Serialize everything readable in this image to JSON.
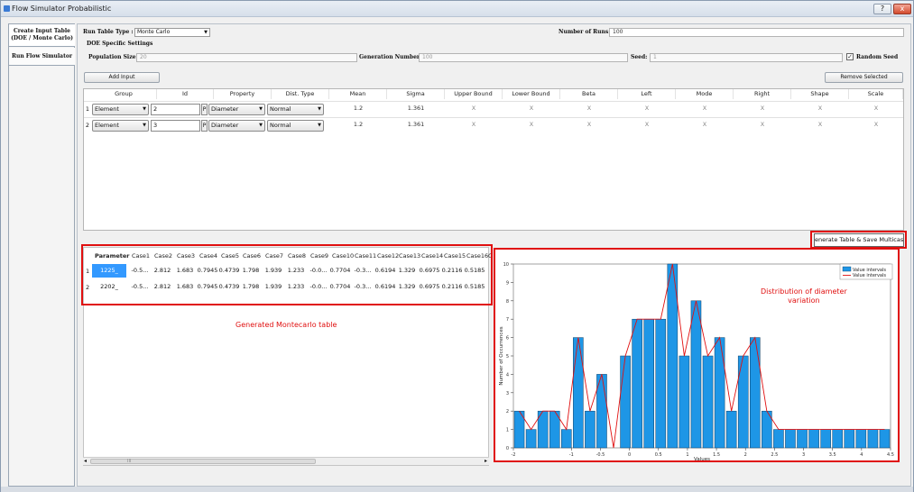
{
  "window": {
    "title": "Flow Simulator Probabilistic",
    "help_label": "?",
    "close_label": "x"
  },
  "sidebar": {
    "tabs": [
      {
        "label": "Create Input Table\n(DOE / Monte Carlo)"
      },
      {
        "label": "Run Flow Simulator"
      }
    ]
  },
  "settings": {
    "run_table_type_label": "Run Table Type :",
    "run_table_type_value": "Monte Carlo",
    "number_of_runs_label": "Number of Runs:",
    "number_of_runs_value": "100",
    "doe_settings_label": "DOE Specific Settings",
    "population_size_label": "Population Size:",
    "population_size_value": "20",
    "generation_number_label": "Generation Number:",
    "generation_number_value": "100",
    "seed_label": "Seed:",
    "seed_value": "1",
    "random_seed_label": "Random Seed",
    "random_seed_checked": true
  },
  "buttons": {
    "add_input": "Add Input",
    "remove_selected": "Remove Selected",
    "generate": "enerate Table & Save Multicase F"
  },
  "input_table": {
    "columns": [
      "Group",
      "Id",
      "Property",
      "Dist. Type",
      "Mean",
      "Sigma",
      "Upper Bound",
      "Lower Bound",
      "Beta",
      "Left",
      "Mode",
      "Right",
      "Shape",
      "Scale"
    ],
    "rows": [
      {
        "num": "1",
        "group": "Element",
        "id": "2",
        "p": "P",
        "property": "Diameter",
        "dist": "Normal",
        "mean": "1.2",
        "sigma": "1.361",
        "upper": "X",
        "lower": "X",
        "beta": "X",
        "left": "X",
        "mode": "X",
        "right": "X",
        "shape": "X",
        "scale": "X"
      },
      {
        "num": "2",
        "group": "Element",
        "id": "3",
        "p": "P",
        "property": "Diameter",
        "dist": "Normal",
        "mean": "1.2",
        "sigma": "1.361",
        "upper": "X",
        "lower": "X",
        "beta": "X",
        "left": "X",
        "mode": "X",
        "right": "X",
        "shape": "X",
        "scale": "X"
      }
    ]
  },
  "mc_table": {
    "headers": [
      "Parameter",
      "Case1",
      "Case2",
      "Case3",
      "Case4",
      "Case5",
      "Case6",
      "Case7",
      "Case8",
      "Case9",
      "Case10",
      "Case11",
      "Case12",
      "Case13",
      "Case14",
      "Case15",
      "Case16",
      "C"
    ],
    "rows": [
      {
        "num": "1",
        "cells": [
          "1225_",
          "-0.5...",
          "2.812",
          "1.683",
          "0.7945",
          "0.4739",
          "1.798",
          "1.939",
          "1.233",
          "-0.0...",
          "0.7704",
          "-0.3...",
          "0.6194",
          "1.329",
          "0.6975",
          "0.2116",
          "0.5185"
        ]
      },
      {
        "num": "2",
        "cells": [
          "2202_",
          "-0.5...",
          "2.812",
          "1.683",
          "0.7945",
          "0.4739",
          "1.798",
          "1.939",
          "1.233",
          "-0.0...",
          "0.7704",
          "-0.3...",
          "0.6194",
          "1.329",
          "0.6975",
          "0.2116",
          "0.5185"
        ]
      }
    ]
  },
  "annotations": {
    "mc_table": "Generated Montecarlo table",
    "chart": "Distribution of diameter\nvariation"
  },
  "scroll": {
    "thumb_label": "III"
  },
  "colors": {
    "bar_fill": "#1e96e6",
    "line": "#e01010",
    "annotation": "#e01010"
  },
  "chart_data": {
    "type": "bar",
    "xlabel": "Values",
    "ylabel": "Number of Occurrences",
    "xlim": [
      -2,
      4.5
    ],
    "ylim": [
      0,
      10
    ],
    "x_ticks": [
      "-2",
      "-1",
      "-0.5",
      "0",
      "0.5",
      "1",
      "1.5",
      "2",
      "2.5",
      "3",
      "3.5",
      "4",
      "4.5"
    ],
    "y_ticks": [
      "0",
      "1",
      "2",
      "3",
      "4",
      "5",
      "6",
      "7",
      "8",
      "9",
      "10"
    ],
    "legend": {
      "placement": "top-right",
      "entries": [
        "Value intervals",
        "Value intervals"
      ]
    },
    "bin_centers": [
      -1.9,
      -1.7,
      -1.5,
      -1.3,
      -1.1,
      -0.9,
      -0.7,
      -0.5,
      -0.3,
      -0.1,
      0.1,
      0.3,
      0.5,
      0.7,
      0.9,
      1.1,
      1.3,
      1.5,
      1.7,
      1.9,
      2.1,
      2.3,
      2.5,
      2.7,
      2.9,
      3.1,
      3.3,
      3.5,
      3.7,
      3.9,
      4.1,
      4.3
    ],
    "values": [
      2,
      1,
      2,
      2,
      1,
      6,
      2,
      4,
      0,
      5,
      7,
      7,
      7,
      10,
      5,
      8,
      5,
      6,
      2,
      5,
      6,
      2,
      1,
      1,
      1,
      1,
      1,
      1,
      1,
      1,
      1,
      1
    ]
  }
}
